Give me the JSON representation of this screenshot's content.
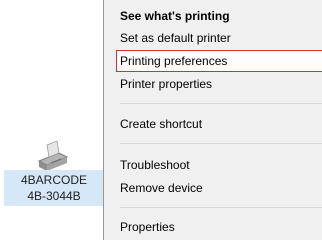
{
  "context_menu": {
    "items": [
      {
        "label": "See what's printing"
      },
      {
        "label": "Set as default printer"
      },
      {
        "label": "Printing preferences"
      },
      {
        "label": "Printer properties"
      },
      {
        "label": "Create shortcut"
      },
      {
        "label": "Troubleshoot"
      },
      {
        "label": "Remove device"
      },
      {
        "label": "Properties"
      }
    ],
    "highlighted_item": "Printing preferences",
    "highlight_color": "#d32f2f"
  },
  "device": {
    "icon": "printer-icon",
    "name_line1": "4BARCODE",
    "name_line2": "4B-3044B"
  }
}
